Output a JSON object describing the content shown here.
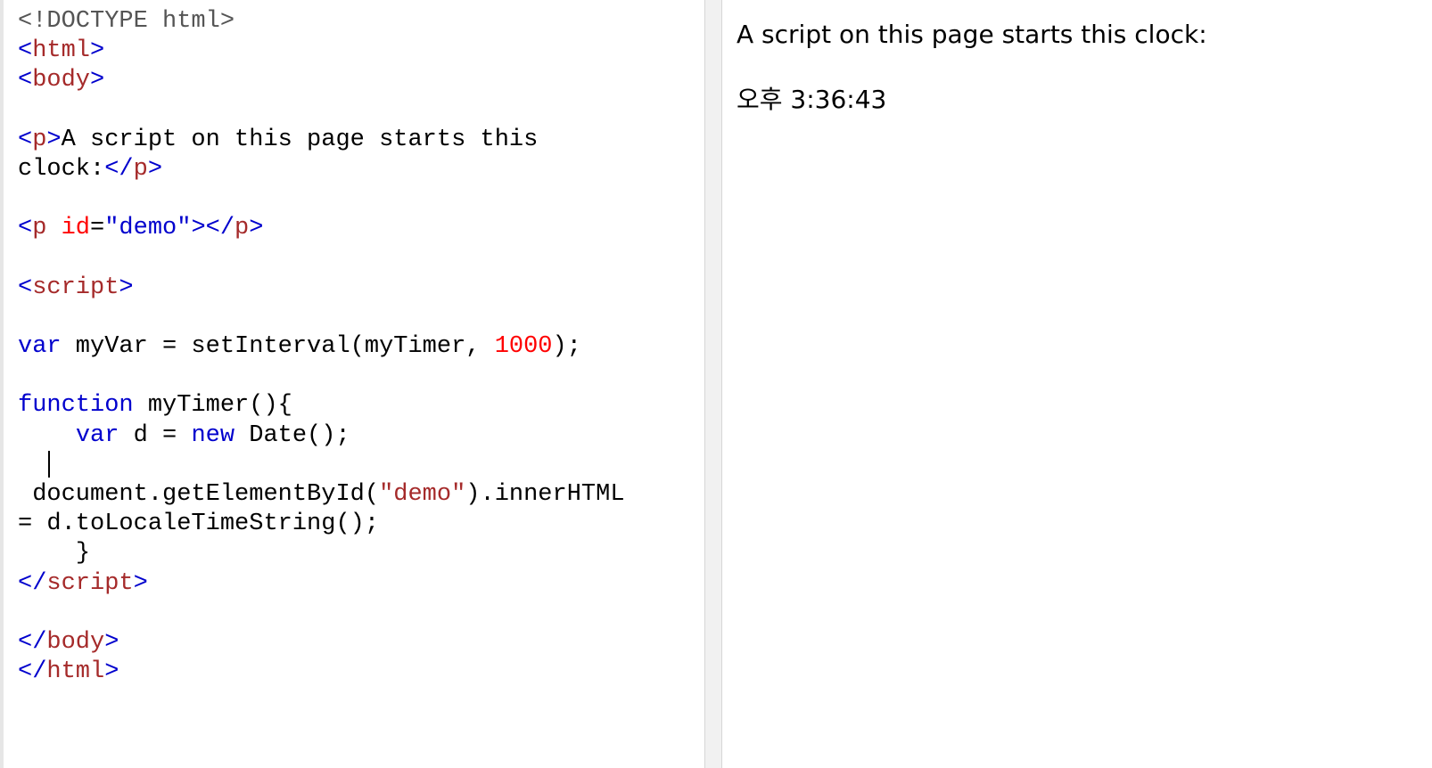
{
  "editor": {
    "l1": "<!DOCTYPE html>",
    "html_open": "html",
    "body_open": "body",
    "p_tag": "p",
    "p_text1": "A script on this page starts this",
    "p_text2": "clock:",
    "demo_attr": "id",
    "demo_val": "\"demo\"",
    "script_tag": "script",
    "var_kw": "var",
    "myvar_text": " myVar = setInterval(myTimer, ",
    "interval_num": "1000",
    "after_num": ");",
    "function_kw": "function",
    "function_rest": " myTimer(){",
    "var_d_rest": " d = ",
    "new_kw": "new",
    "date_call": " Date();",
    "getel_text": " document.getElementById(",
    "demo_str": "\"demo\"",
    "inner_html": ").innerHTML",
    "assign_text": "= d.toLocaleTimeString();",
    "close_brace": "}",
    "body_tag": "body",
    "html_tag": "html"
  },
  "result": {
    "intro": "A script on this page starts this clock:",
    "clock": "오후 3:36:43"
  }
}
